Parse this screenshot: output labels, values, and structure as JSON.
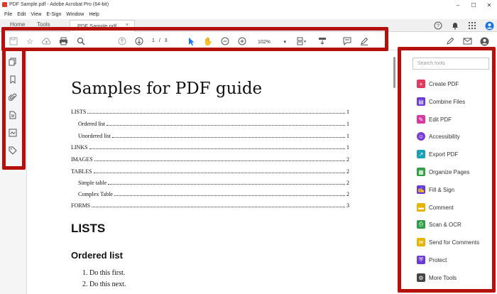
{
  "window": {
    "title": "PDF Sample.pdf - Adobe Acrobat Pro (64-bit)"
  },
  "menubar": {
    "items": [
      "File",
      "Edit",
      "View",
      "E-Sign",
      "Window",
      "Help"
    ]
  },
  "tabs": {
    "home": "Home",
    "tools": "Tools",
    "document": "PDF Sample.pdf",
    "close": "×"
  },
  "toolbar": {
    "page_current": "1",
    "page_separator": "/",
    "page_total": "3",
    "zoom": "102%",
    "zoom_arrow": "▾"
  },
  "document": {
    "title": "Samples for PDF guide",
    "toc": [
      {
        "label": "LISTS",
        "page": "1",
        "level": 0
      },
      {
        "label": "Ordered list",
        "page": "1",
        "level": 1
      },
      {
        "label": "Unordered list",
        "page": "1",
        "level": 1
      },
      {
        "label": "LINKS",
        "page": "1",
        "level": 0
      },
      {
        "label": "IMAGES",
        "page": "2",
        "level": 0
      },
      {
        "label": "TABLES",
        "page": "2",
        "level": 0
      },
      {
        "label": "Simple table",
        "page": "2",
        "level": 1
      },
      {
        "label": "Complex Table",
        "page": "2",
        "level": 1
      },
      {
        "label": "FORMS",
        "page": "3",
        "level": 0
      }
    ],
    "heading_lists": "LISTS",
    "heading_ordered": "Ordered list",
    "list_items": [
      "1.  Do this first.",
      "2.  Do this next."
    ]
  },
  "tools_panel": {
    "search_placeholder": "Search tools",
    "tools": [
      {
        "label": "Create PDF",
        "icon": "create-pdf-icon",
        "color": "#e03a5f"
      },
      {
        "label": "Combine Files",
        "icon": "combine-files-icon",
        "color": "#6a3bd6"
      },
      {
        "label": "Edit PDF",
        "icon": "edit-pdf-icon",
        "color": "#d63aa0"
      },
      {
        "label": "Accessibility",
        "icon": "accessibility-icon",
        "color": "#7a3ad6"
      },
      {
        "label": "Export PDF",
        "icon": "export-pdf-icon",
        "color": "#19a0b8"
      },
      {
        "label": "Organize Pages",
        "icon": "organize-pages-icon",
        "color": "#2f9e44"
      },
      {
        "label": "Fill & Sign",
        "icon": "fill-sign-icon",
        "color": "#6a3bd6"
      },
      {
        "label": "Comment",
        "icon": "comment-icon",
        "color": "#e8b400"
      },
      {
        "label": "Scan & OCR",
        "icon": "scan-ocr-icon",
        "color": "#2f9e44"
      },
      {
        "label": "Send for Comments",
        "icon": "send-comments-icon",
        "color": "#e8b400"
      },
      {
        "label": "Protect",
        "icon": "protect-icon",
        "color": "#6a3bd6"
      },
      {
        "label": "More Tools",
        "icon": "more-tools-icon",
        "color": "#444444"
      }
    ]
  },
  "colors": {
    "highlight_border": "#b4100c",
    "active_tool": "#1a73e8"
  }
}
